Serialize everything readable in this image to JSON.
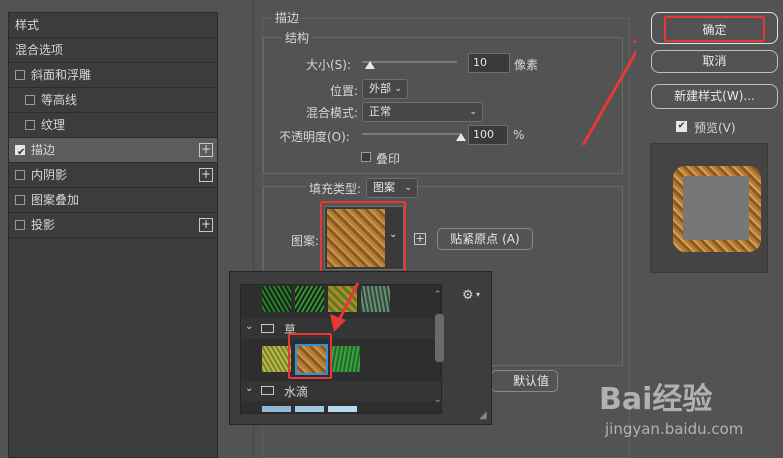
{
  "styles_panel": {
    "header": "样式",
    "items": [
      {
        "label": "混合选项",
        "checkbox": false,
        "checked": false,
        "plus": false,
        "selected": false
      },
      {
        "label": "斜面和浮雕",
        "checkbox": true,
        "checked": false,
        "plus": false,
        "selected": false
      },
      {
        "label": "等高线",
        "checkbox": true,
        "checked": false,
        "plus": false,
        "selected": false
      },
      {
        "label": "纹理",
        "checkbox": true,
        "checked": false,
        "plus": false,
        "selected": false
      },
      {
        "label": "描边",
        "checkbox": true,
        "checked": true,
        "plus": true,
        "selected": true
      },
      {
        "label": "内阴影",
        "checkbox": true,
        "checked": false,
        "plus": true,
        "selected": false
      },
      {
        "label": "图案叠加",
        "checkbox": true,
        "checked": false,
        "plus": false,
        "selected": false
      },
      {
        "label": "投影",
        "checkbox": true,
        "checked": false,
        "plus": true,
        "selected": false
      }
    ]
  },
  "stroke": {
    "section_title": "描边",
    "structure_title": "结构",
    "size_label": "大小(S):",
    "size_value": "10",
    "size_unit": "像素",
    "position_label": "位置:",
    "position_value": "外部",
    "blend_label": "混合模式:",
    "blend_value": "正常",
    "opacity_label": "不透明度(O):",
    "opacity_value": "100",
    "opacity_unit": "%",
    "opacity_level": 1.0,
    "size_level": 0.08,
    "overprint_label": "叠印",
    "fill_type_label": "填充类型:",
    "fill_type_value": "图案",
    "pattern_label": "图案:",
    "snap_origin_label": "贴紧原点 (A)",
    "default_label": "默认值"
  },
  "pattern_picker": {
    "groups": [
      {
        "label": "草"
      },
      {
        "label": "水滴"
      }
    ]
  },
  "buttons": {
    "ok": "确定",
    "cancel": "取消",
    "new_style": "新建样式(W)...",
    "preview_label": "预览(V)"
  },
  "watermark": {
    "brand": "Bai经验",
    "url": "jingyan.baidu.com"
  },
  "colors": {
    "panel_bg": "#535353",
    "highlight_red": "#e53935",
    "selection_blue": "#2f8fe0"
  }
}
